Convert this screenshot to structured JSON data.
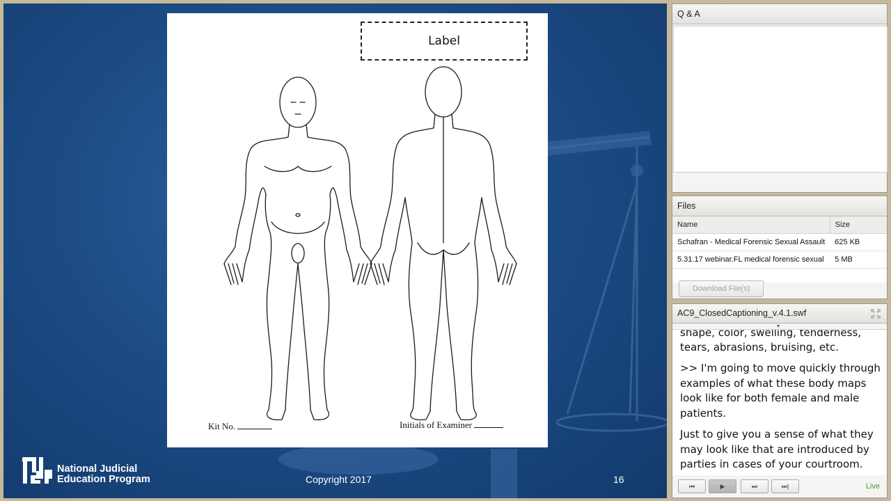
{
  "slide": {
    "document": {
      "label": "Label",
      "kit_no": "Kit No.",
      "initials": "Initials of Examiner"
    },
    "logo": {
      "icon": "njep-logo-icon",
      "line1": "National Judicial",
      "line2": "Education Program"
    },
    "copyright": "Copyright 2017",
    "page_number": "16"
  },
  "qa_pod": {
    "title": "Q & A"
  },
  "files_pod": {
    "title": "Files",
    "columns": [
      "Name",
      "Size"
    ],
    "rows": [
      {
        "name": "Schafran - Medical Forensic Sexual Assault",
        "size": "625 KB"
      },
      {
        "name": "5.31.17 webinar.FL medical forensic sexual",
        "size": "5 MB"
      }
    ],
    "download_label": "Download File(s)"
  },
  "captions_pod": {
    "title": "AC9_ClosedCaptioning_v.4.1.swf",
    "paragraphs": [
      "shape, color, swelling, tenderness, tears, abrasions, bruising, etc.",
      ">> I'm going to move quickly through examples of what these body maps look like for both female and male patients.",
      "Just to give you a sense of what they may look like that are introduced by parties in cases of your courtroom."
    ],
    "controls": [
      "⏮",
      "▶",
      "⏭",
      "⏭|"
    ],
    "live_label": "Live"
  },
  "colors": {
    "slide_bg": "#1d4c86",
    "live_green": "#3f9c3f"
  }
}
